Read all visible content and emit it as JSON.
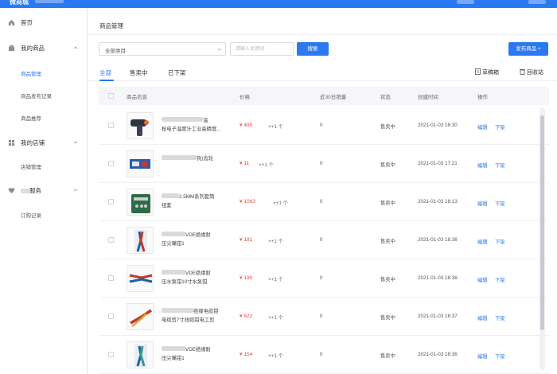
{
  "app": {
    "logo": "微商城"
  },
  "sidebar": {
    "home": "首页",
    "groups": [
      {
        "label": "我的商品",
        "items": [
          "商品管理",
          "商品发布记录",
          "商品推荐"
        ]
      },
      {
        "label": "我的店铺",
        "items": [
          "店铺管理"
        ]
      },
      {
        "label": "服务",
        "items": [
          "订购记录"
        ]
      }
    ]
  },
  "page": {
    "title": "商品管理",
    "category_select": "全部类目",
    "search_placeholder": "请输入关键词",
    "search_button": "搜索",
    "publish_button": "发布商品 +",
    "tabs": [
      "全部",
      "售卖中",
      "已下架"
    ],
    "draft_label": "草稿箱",
    "recycle_label": "回收站"
  },
  "table": {
    "headers": [
      "商品信息",
      "价格",
      "近30日销量",
      "状态",
      "创建时间",
      "操作"
    ],
    "rows": [
      {
        "title_a": "温",
        "title_b": "枪电子温度计工业高精度...",
        "price": "¥ 495",
        "stock": "×+1 个",
        "sales": "0",
        "status": "售卖中",
        "created": "2021-01-03 16:30",
        "edit": "编辑",
        "offline": "下架"
      },
      {
        "title_a": "钩)齿轮",
        "title_b": "",
        "price": "¥ 11",
        "stock": "×+1 个",
        "sales": "0",
        "status": "售卖中",
        "created": "2021-01-03 17:21",
        "edit": "编辑",
        "offline": "下架"
      },
      {
        "title_a": "2.5MM系列套筒",
        "title_b": "组套",
        "price": "¥ 1063",
        "stock": "×+1 个",
        "sales": "0",
        "status": "售卖中",
        "created": "2021-01-03 18:13",
        "edit": "编辑",
        "offline": "下架"
      },
      {
        "title_a": "VDE绝缘耐",
        "title_b": "压尖嘴钳1",
        "price": "¥ 181",
        "stock": "×+1 个",
        "sales": "0",
        "status": "售卖中",
        "created": "2021-01-03 18:36",
        "edit": "编辑",
        "offline": "下架"
      },
      {
        "title_a": "VDE绝缘耐",
        "title_b": "压水泵钳10寸水泵钳",
        "price": "¥ 190",
        "stock": "×+1 个",
        "sales": "0",
        "status": "售卖中",
        "created": "2021-01-03 18:36",
        "edit": "编辑",
        "offline": "下架"
      },
      {
        "title_a": "绝缘电缆钳",
        "title_b": "电缆剪7寸线缆钳电工剪",
        "price": "¥ 622",
        "stock": "×+1 个",
        "sales": "0",
        "status": "售卖中",
        "created": "2021-01-03 18:37",
        "edit": "编辑",
        "offline": "下架"
      },
      {
        "title_a": "VDE绝缘耐",
        "title_b": "压尖嘴钳1",
        "price": "¥ 154",
        "stock": "×+1 个",
        "sales": "0",
        "status": "售卖中",
        "created": "2021-01-03 18:36",
        "edit": "编辑",
        "offline": "下架"
      }
    ]
  },
  "colors": {
    "accent": "#2b79f1",
    "price": "#e0463c"
  }
}
